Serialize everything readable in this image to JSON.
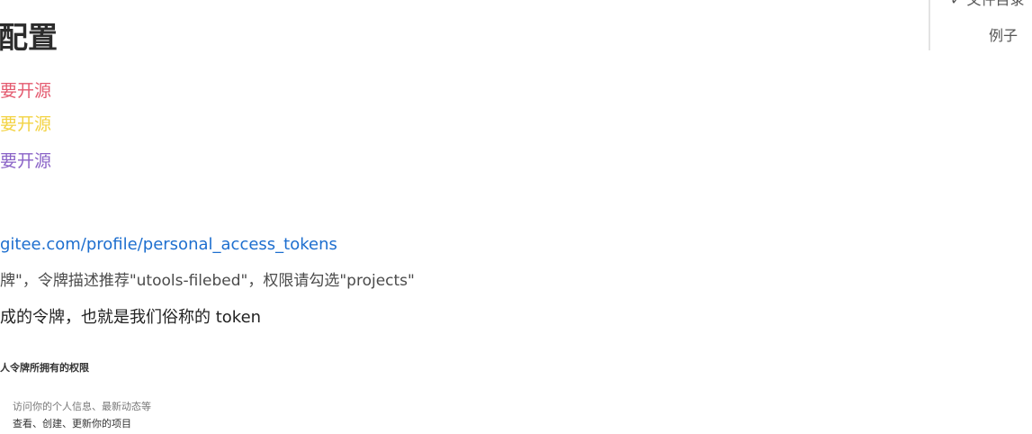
{
  "doc": {
    "heading": "配置",
    "lines": [
      {
        "text": "要开源",
        "color": "#e45a6f"
      },
      {
        "text": "要开源",
        "color": "#f3d343"
      },
      {
        "text": "要开源",
        "color": "#8a63c7"
      }
    ],
    "link": "gitee.com/profile/personal_access_tokens",
    "description": "牌\"，令牌描述推荐\"utools-filebed\"，权限请勾选\"projects\"",
    "note": "成的令牌，也就是我们俗称的 token"
  },
  "screenshot_inset": {
    "heading": "人令牌所拥有的权限",
    "items": [
      "访问你的个人信息、最新动态等",
      "查看、创建、更新你的项目"
    ]
  },
  "toc": {
    "item1": "✓ 文件目录",
    "item2": "例子"
  }
}
